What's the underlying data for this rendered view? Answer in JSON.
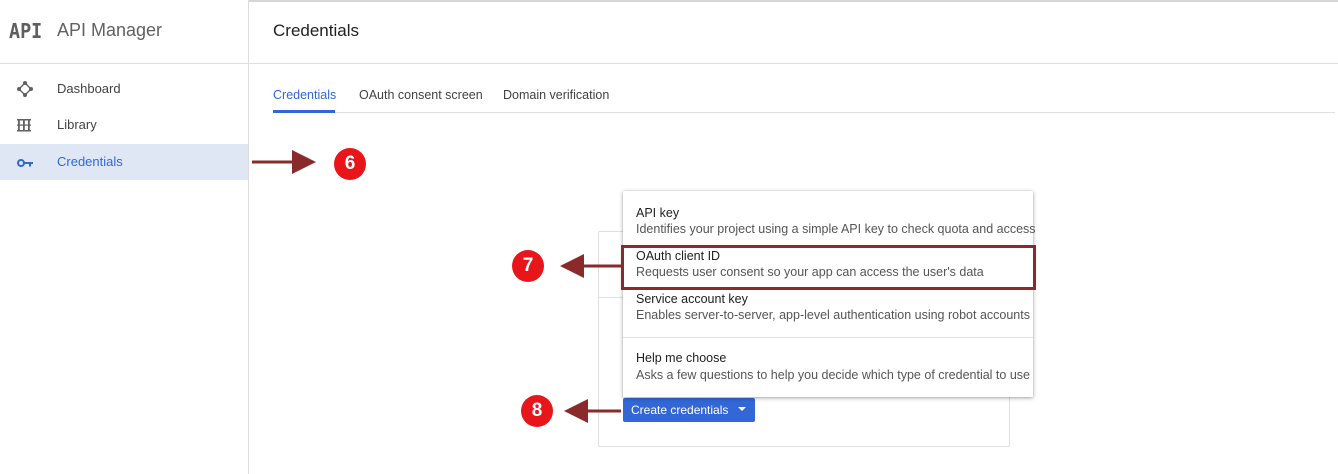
{
  "app": {
    "logo_text": "API",
    "title": "API Manager"
  },
  "sidebar": {
    "items": [
      {
        "label": "Dashboard",
        "icon": "dashboard-icon",
        "active": false
      },
      {
        "label": "Library",
        "icon": "library-icon",
        "active": false
      },
      {
        "label": "Credentials",
        "icon": "key-icon",
        "active": true
      }
    ]
  },
  "main": {
    "title": "Credentials",
    "tabs": [
      {
        "label": "Credentials",
        "active": true
      },
      {
        "label": "OAuth consent screen",
        "active": false
      },
      {
        "label": "Domain verification",
        "active": false
      }
    ],
    "create_button": {
      "label": "Create credentials",
      "icon": "caret-down-icon"
    }
  },
  "menu": {
    "items": [
      {
        "title": "API key",
        "description": "Identifies your project using a simple API key to check quota and access"
      },
      {
        "title": "OAuth client ID",
        "description": "Requests user consent so your app can access the user's data"
      },
      {
        "title": "Service account key",
        "description": "Enables server-to-server, app-level authentication using robot accounts"
      },
      {
        "title": "Help me choose",
        "description": "Asks a few questions to help you decide which type of credential to use"
      }
    ]
  },
  "annotations": {
    "step_6": "6",
    "step_7": "7",
    "step_8": "8"
  },
  "colors": {
    "accent_blue": "#3367d6",
    "active_nav_bg": "#dfe7f5",
    "annotation_red": "#e8161b",
    "arrow_dark_red": "#8b2a2a"
  }
}
